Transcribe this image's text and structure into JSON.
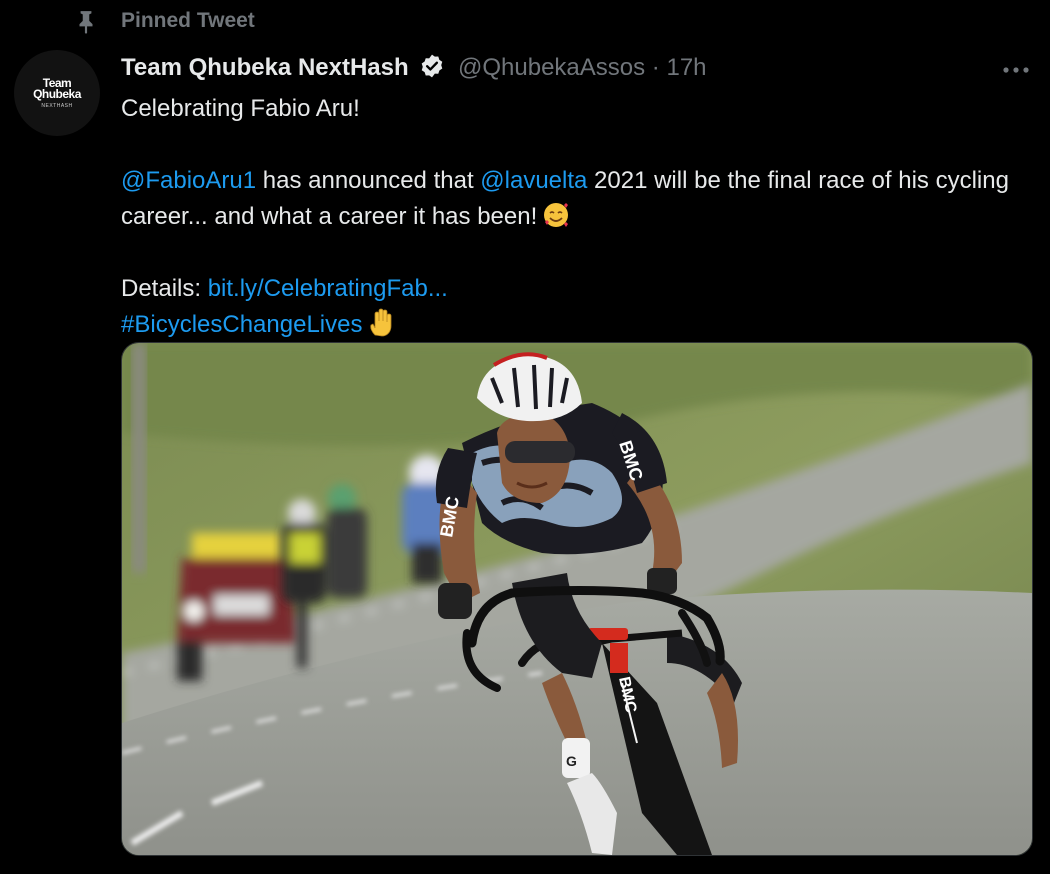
{
  "pinned": {
    "label": "Pinned Tweet",
    "icon": "pin-icon"
  },
  "avatar": {
    "line1": "Team",
    "line2": "Qhubeka",
    "sub": "NEXTHASH"
  },
  "tweet": {
    "author_name": "Team Qhubeka NextHash",
    "handle": "@QhubekaAssos",
    "separator": "·",
    "time": "17h",
    "line1": "Celebrating Fabio Aru!",
    "mention1": "@FabioAru1",
    "text_a": " has announced that ",
    "mention2": "@lavuelta",
    "text_b": " 2021 will be the final race of his cycling career... and what a career it has been!",
    "details_label": "Details: ",
    "link": "bit.ly/CelebratingFab...",
    "hashtag": "#BicyclesChangeLives"
  },
  "media": {
    "jersey_brand": "BMC",
    "sock_brand": "G"
  },
  "colors": {
    "background": "#000000",
    "text": "#e7e9ea",
    "secondary": "#71767b",
    "link": "#1d9bf0",
    "verified": "#e7e9ea"
  }
}
